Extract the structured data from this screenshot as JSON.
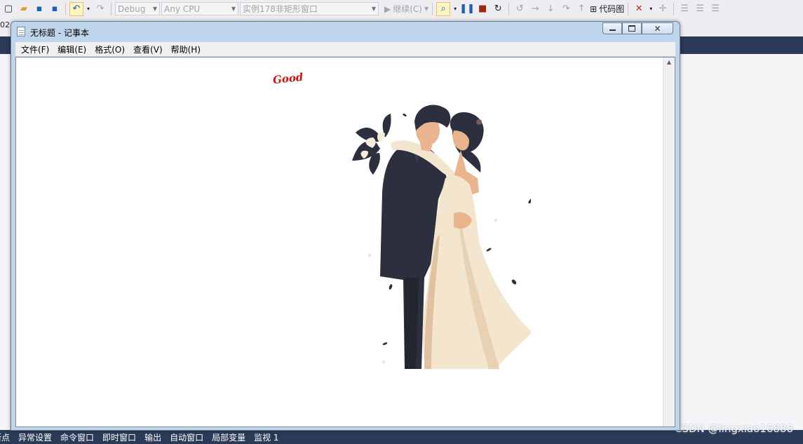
{
  "toolbar": {
    "config_combo": "Debug",
    "platform_combo": "Any CPU",
    "startup_project_combo": "实例178非矩形窗口",
    "continue_label": "继续(C)",
    "code_map_label": "代码图"
  },
  "tabstrip": {
    "stub_text": "02"
  },
  "statusbar": {
    "items": [
      "断点",
      "异常设置",
      "命令窗口",
      "即时窗口",
      "输出",
      "自动窗口",
      "局部变量",
      "监视 1"
    ]
  },
  "watermark": "CSDN @lingxiao16888",
  "notepad": {
    "title": "无标题 - 记事本",
    "menu": [
      "文件(F)",
      "编辑(E)",
      "格式(O)",
      "查看(V)",
      "帮助(H)"
    ],
    "content_text": "Good"
  },
  "colors": {
    "vs_dark_bar": "#2b3a57",
    "good_text": "#c8140c",
    "suit": "#2c2f3e",
    "dress": "#f4e5cf"
  },
  "icons": {
    "close": "close-icon",
    "minimize": "minimize-icon",
    "maximize": "maximize-icon"
  }
}
